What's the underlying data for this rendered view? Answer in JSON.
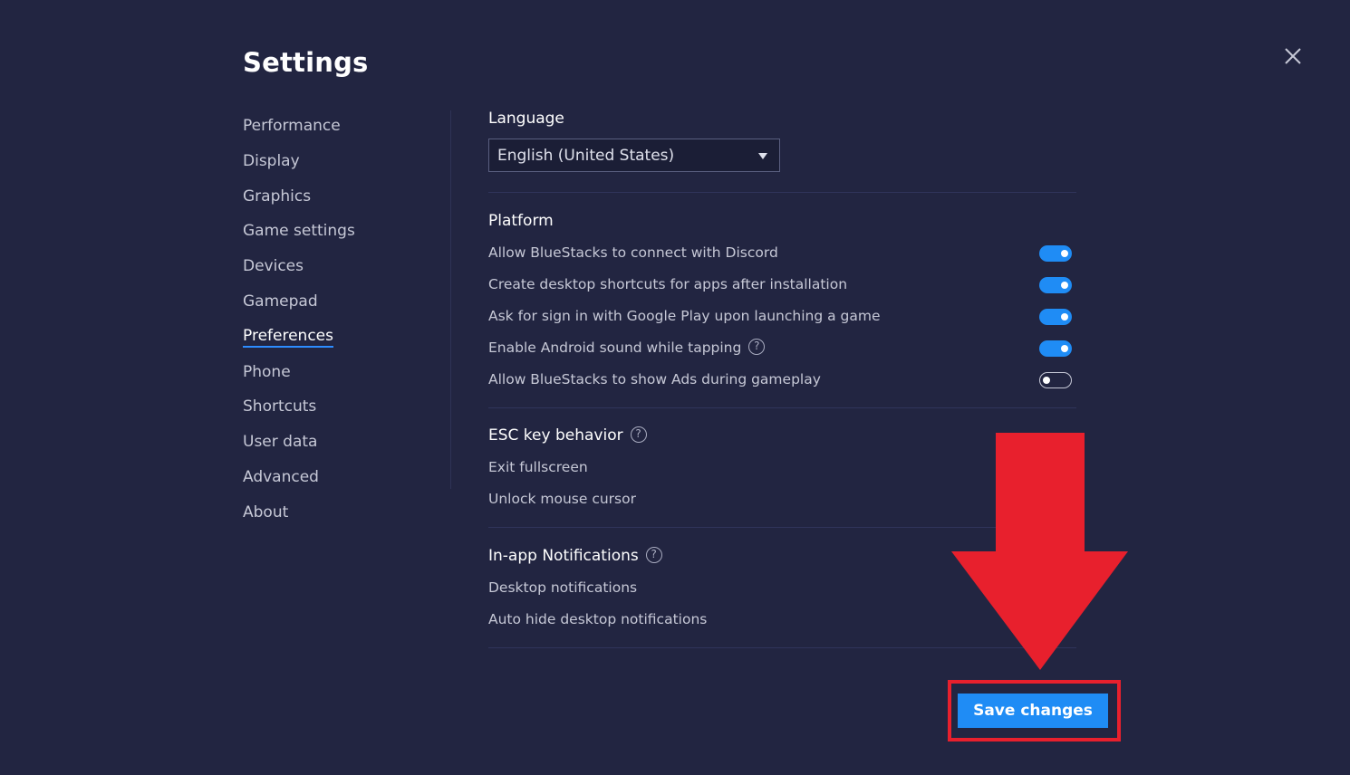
{
  "header": {
    "title": "Settings"
  },
  "sidebar": {
    "items": [
      {
        "label": "Performance"
      },
      {
        "label": "Display"
      },
      {
        "label": "Graphics"
      },
      {
        "label": "Game settings"
      },
      {
        "label": "Devices"
      },
      {
        "label": "Gamepad"
      },
      {
        "label": "Preferences",
        "active": true
      },
      {
        "label": "Phone"
      },
      {
        "label": "Shortcuts"
      },
      {
        "label": "User data"
      },
      {
        "label": "Advanced"
      },
      {
        "label": "About"
      }
    ]
  },
  "language": {
    "heading": "Language",
    "selected": "English (United States)"
  },
  "platform": {
    "heading": "Platform",
    "options": [
      {
        "label": "Allow BlueStacks to connect with Discord",
        "enabled": true
      },
      {
        "label": "Create desktop shortcuts for apps after installation",
        "enabled": true
      },
      {
        "label": "Ask for sign in with Google Play upon launching a game",
        "enabled": true
      },
      {
        "label": "Enable Android sound while tapping",
        "enabled": true,
        "help": "?"
      },
      {
        "label": "Allow BlueStacks to show Ads during gameplay",
        "enabled": false
      }
    ]
  },
  "esc_key": {
    "heading": "ESC key behavior",
    "help": "?",
    "options": [
      {
        "label": "Exit fullscreen"
      },
      {
        "label": "Unlock mouse cursor"
      }
    ]
  },
  "notifications": {
    "heading": "In-app Notifications",
    "help": "?",
    "options": [
      {
        "label": "Desktop notifications"
      },
      {
        "label": "Auto hide desktop notifications"
      }
    ]
  },
  "footer": {
    "save_label": "Save changes"
  },
  "icons": {
    "close": "close-icon",
    "dropdown": "chevron-down-icon",
    "help": "help-circle-icon",
    "annotation": "red-arrow-down"
  },
  "colors": {
    "background": "#222541",
    "accent": "#1f8cf5",
    "annotation": "#e8202d"
  }
}
